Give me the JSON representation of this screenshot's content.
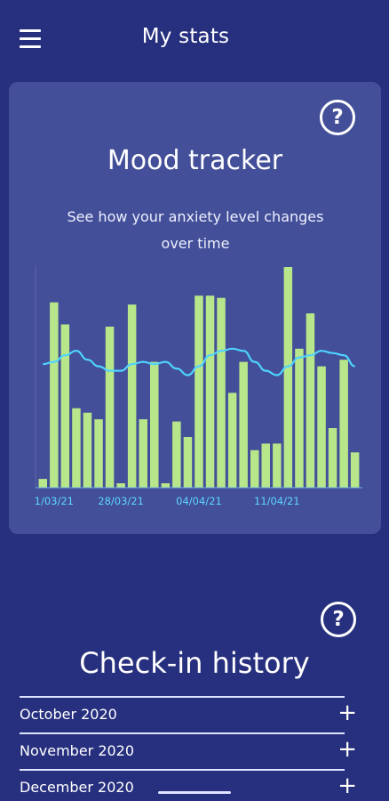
{
  "header": {
    "title": "My stats",
    "menu_icon": "hamburger-menu-icon"
  },
  "mood_tracker": {
    "title": "Mood tracker",
    "subtitle": "See how your anxiety level changes over time",
    "help_icon": "question-mark-icon",
    "help_label": "?"
  },
  "chart_data": {
    "type": "bar",
    "bar_color": "#b8e68a",
    "line_color": "#4fd3ff",
    "tick_color": "#5dd6ff",
    "x_tick_labels": [
      "1/03/21",
      "28/03/21",
      "04/04/21",
      "11/04/21"
    ],
    "x_tick_positions": [
      1,
      7,
      14,
      21
    ],
    "values": [
      0.4,
      8.4,
      7.4,
      3.6,
      3.4,
      3.1,
      7.3,
      0.2,
      8.3,
      3.1,
      5.7,
      0.2,
      3.0,
      2.3,
      8.7,
      8.7,
      8.6,
      4.3,
      5.7,
      1.7,
      2.0,
      2.0,
      10.0,
      6.3,
      7.9,
      5.5,
      2.7,
      5.8,
      1.6
    ],
    "trend": [
      5.6,
      5.7,
      6.0,
      6.2,
      5.8,
      5.5,
      5.3,
      5.3,
      5.6,
      5.7,
      5.6,
      5.7,
      5.4,
      5.1,
      5.5,
      6.0,
      6.2,
      6.3,
      6.2,
      5.7,
      5.3,
      5.1,
      5.5,
      5.9,
      6.0,
      6.2,
      6.1,
      6.0,
      5.5
    ],
    "ylim": [
      0,
      10
    ]
  },
  "history": {
    "title": "Check-in history",
    "help_label": "?",
    "help_icon": "question-mark-icon",
    "expand_label": "+",
    "items": [
      {
        "label": "October 2020"
      },
      {
        "label": "November 2020"
      },
      {
        "label": "December 2020"
      }
    ]
  }
}
